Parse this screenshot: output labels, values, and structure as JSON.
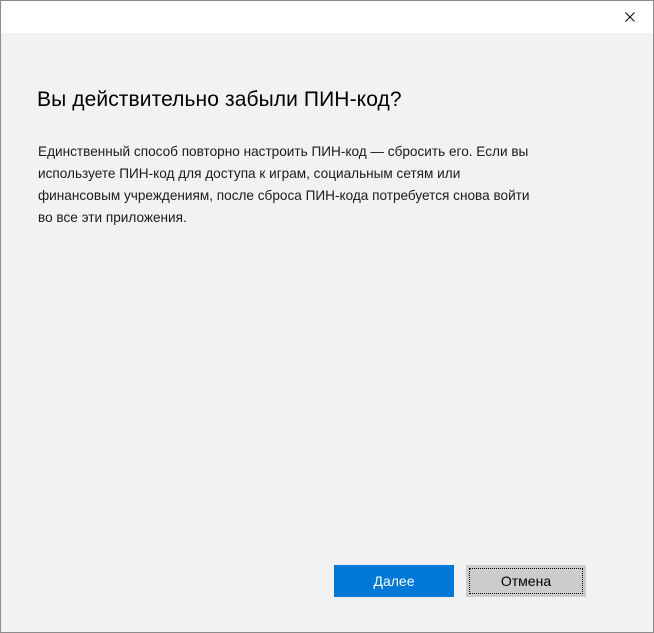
{
  "titlebar": {
    "close_icon": "close-icon"
  },
  "dialog": {
    "title": "Вы действительно забыли ПИН-код?",
    "body_lines": [
      "Единственный способ повторно настроить ПИН-код — сбросить его. Если вы",
      "используете ПИН-код для доступа к играм, социальным сетям или",
      "финансовым учреждениям, после сброса ПИН-кода потребуется снова войти",
      "во все эти приложения."
    ]
  },
  "buttons": {
    "next_label": "Далее",
    "cancel_label": "Отмена"
  },
  "colors": {
    "accent": "#0078d7",
    "background": "#f2f2f2",
    "titlebar": "#ffffff",
    "secondary_button": "#cccccc"
  }
}
